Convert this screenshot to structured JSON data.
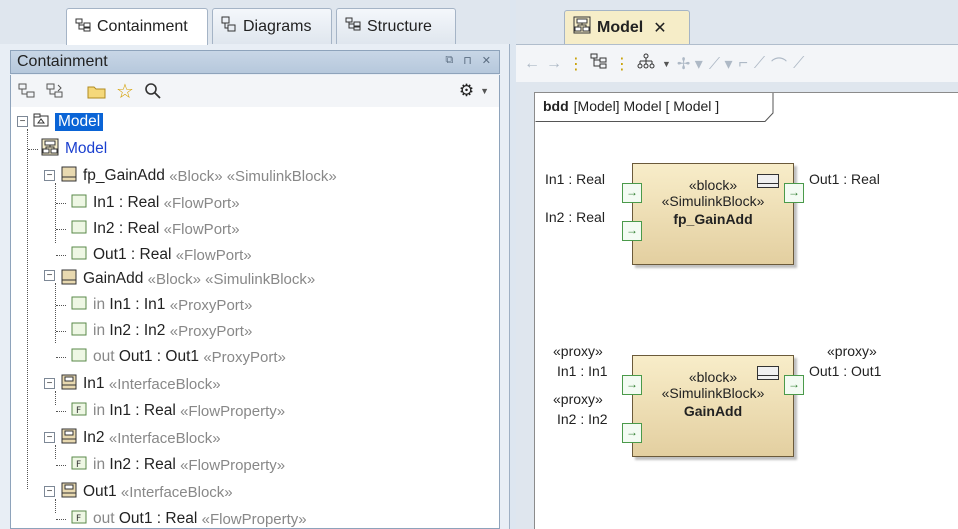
{
  "left_tabs": [
    {
      "label": "Containment"
    },
    {
      "label": "Diagrams"
    },
    {
      "label": "Structure"
    }
  ],
  "panel": {
    "title": "Containment"
  },
  "tree": {
    "root": {
      "label": "Model"
    },
    "diagram": {
      "label": "Model"
    },
    "fp_gainadd": {
      "name": "fp_GainAdd",
      "stereo": "«Block» «SimulinkBlock»"
    },
    "fp_in1": {
      "name": "In1 : Real",
      "stereo": "«FlowPort»"
    },
    "fp_in2": {
      "name": "In2 : Real",
      "stereo": "«FlowPort»"
    },
    "fp_out1": {
      "name": "Out1 : Real",
      "stereo": "«FlowPort»"
    },
    "gainadd": {
      "name": "GainAdd",
      "stereo": "«Block» «SimulinkBlock»"
    },
    "ga_in1": {
      "dir": "in",
      "name": "In1",
      "type": ": In1",
      "stereo": "«ProxyPort»"
    },
    "ga_in2": {
      "dir": "in",
      "name": "In2",
      "type": ": In2",
      "stereo": "«ProxyPort»"
    },
    "ga_out1": {
      "dir": "out",
      "name": "Out1",
      "type": ": Out1",
      "stereo": "«ProxyPort»"
    },
    "ib_in1": {
      "name": "In1",
      "stereo": "«InterfaceBlock»"
    },
    "ib_in1_prop": {
      "dir": "in",
      "name": "In1",
      "type": ": Real",
      "stereo": "«FlowProperty»"
    },
    "ib_in2": {
      "name": "In2",
      "stereo": "«InterfaceBlock»"
    },
    "ib_in2_prop": {
      "dir": "in",
      "name": "In2",
      "type": ": Real",
      "stereo": "«FlowProperty»"
    },
    "ib_out1": {
      "name": "Out1",
      "stereo": "«InterfaceBlock»"
    },
    "ib_out1_prop": {
      "dir": "out",
      "name": "Out1",
      "type": ": Real",
      "stereo": "«FlowProperty»"
    }
  },
  "right_tab": {
    "label": "Model",
    "close": "✕"
  },
  "diagram": {
    "frame": {
      "kind": "bdd",
      "text": "[Model] Model [ Model ]"
    },
    "block1": {
      "stereo1": "«block»",
      "stereo2": "«SimulinkBlock»",
      "name": "fp_GainAdd",
      "in1": "In1 : Real",
      "in2": "In2 : Real",
      "out1": "Out1 : Real"
    },
    "block2": {
      "stereo1": "«block»",
      "stereo2": "«SimulinkBlock»",
      "name": "GainAdd",
      "in1_stereo": "«proxy»",
      "in1": "In1 : In1",
      "in2_stereo": "«proxy»",
      "in2": "In2 : In2",
      "out1_stereo": "«proxy»",
      "out1": "Out1 : Out1"
    }
  },
  "icons": {
    "close": "✕",
    "pin": "⊓",
    "star": "☆",
    "search": "⌕",
    "gear": "⚙",
    "back": "←",
    "forward": "→"
  }
}
